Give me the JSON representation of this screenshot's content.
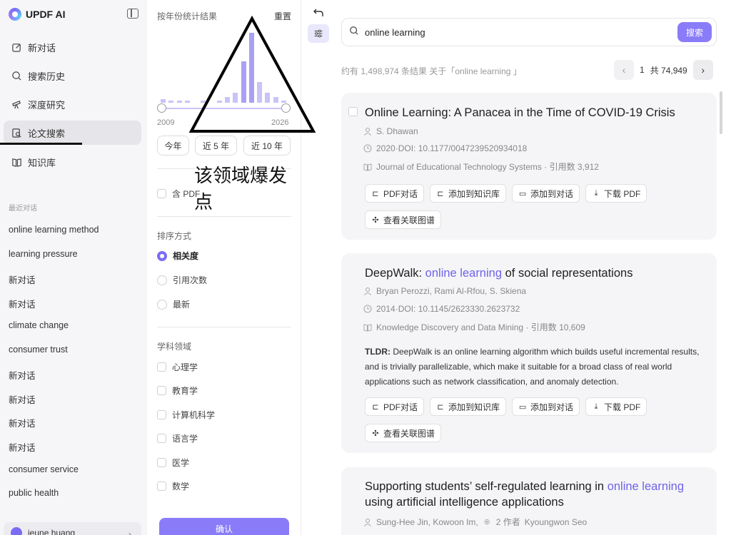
{
  "app": {
    "name": "UPDF AI"
  },
  "sidebar": {
    "nav": [
      {
        "label": "新对话",
        "icon": "edit-icon"
      },
      {
        "label": "搜索历史",
        "icon": "search-icon"
      },
      {
        "label": "深度研究",
        "icon": "telescope-icon"
      },
      {
        "label": "论文搜索",
        "icon": "paper-search-icon"
      },
      {
        "label": "知识库",
        "icon": "book-icon"
      }
    ],
    "recent_title": "最近对话",
    "recent": [
      "online learning method",
      "learning pressure",
      "新对话",
      "新对话",
      "climate change",
      "consumer trust",
      "新对话",
      "新对话",
      "新对话",
      "新对话",
      "consumer service",
      "public health"
    ],
    "user": "jeune huang"
  },
  "filter": {
    "title": "按年份统计结果",
    "reset": "重置",
    "year_start": "2009",
    "year_end": "2026",
    "pills": [
      "今年",
      "近 5 年",
      "近 10 年"
    ],
    "annotation": "该领域爆发点",
    "pdf_label": "含 PDF",
    "sort_title": "排序方式",
    "sort_options": [
      "相关度",
      "引用次数",
      "最新"
    ],
    "sort_selected": "相关度",
    "field_title": "学科领域",
    "fields": [
      "心理学",
      "教育学",
      "计算机科学",
      "语言学",
      "医学",
      "数学"
    ],
    "confirm": "确认"
  },
  "histogram": {
    "type": "bar",
    "values": [
      4,
      3,
      3,
      3,
      0,
      3,
      0,
      3,
      7,
      12,
      50,
      85,
      25,
      12,
      7,
      3
    ]
  },
  "search": {
    "query": "online learning",
    "button": "搜索",
    "result_count": "约有 1,498,974 条结果 关于「online learning 」",
    "page": "1",
    "total_pages": "共 74,949"
  },
  "results": [
    {
      "title": "Online Learning: A Panacea in the Time of COVID-19 Crisis",
      "authors": "S. Dhawan",
      "doi": "2020·DOI: 10.1177/0047239520934018",
      "venue": "Journal of Educational Technology Systems · 引用数 3,912"
    },
    {
      "title_pre": "DeepWalk: ",
      "title_hl": "online learning",
      "title_post": " of social representations",
      "authors": "Bryan Perozzi,  Rami Al-Rfou,  S. Skiena",
      "doi": "2014·DOI: 10.1145/2623330.2623732",
      "venue": "Knowledge Discovery and Data Mining · 引用数 10,609",
      "tldr_label": "TLDR:",
      "tldr": " DeepWalk is an online learning algorithm which builds useful incremental results, and is trivially parallelizable, which make it suitable for a broad class of real world applications such as network classification, and anomaly detection."
    },
    {
      "title_pre": "Supporting students’  self-regulated learning in ",
      "title_hl": "online learning",
      "title_post": " using artificial intelligence applications",
      "authors": "Sung-Hee Jin,  Kowoon Im,",
      "more_authors": "2 作者",
      "last_author": "Kyoungwon Seo"
    }
  ],
  "actions": {
    "pdf_chat": "PDF对话",
    "add_kb": "添加到知识库",
    "add_chat": "添加到对话",
    "download": "下载 PDF",
    "graph": "查看关联图谱"
  }
}
